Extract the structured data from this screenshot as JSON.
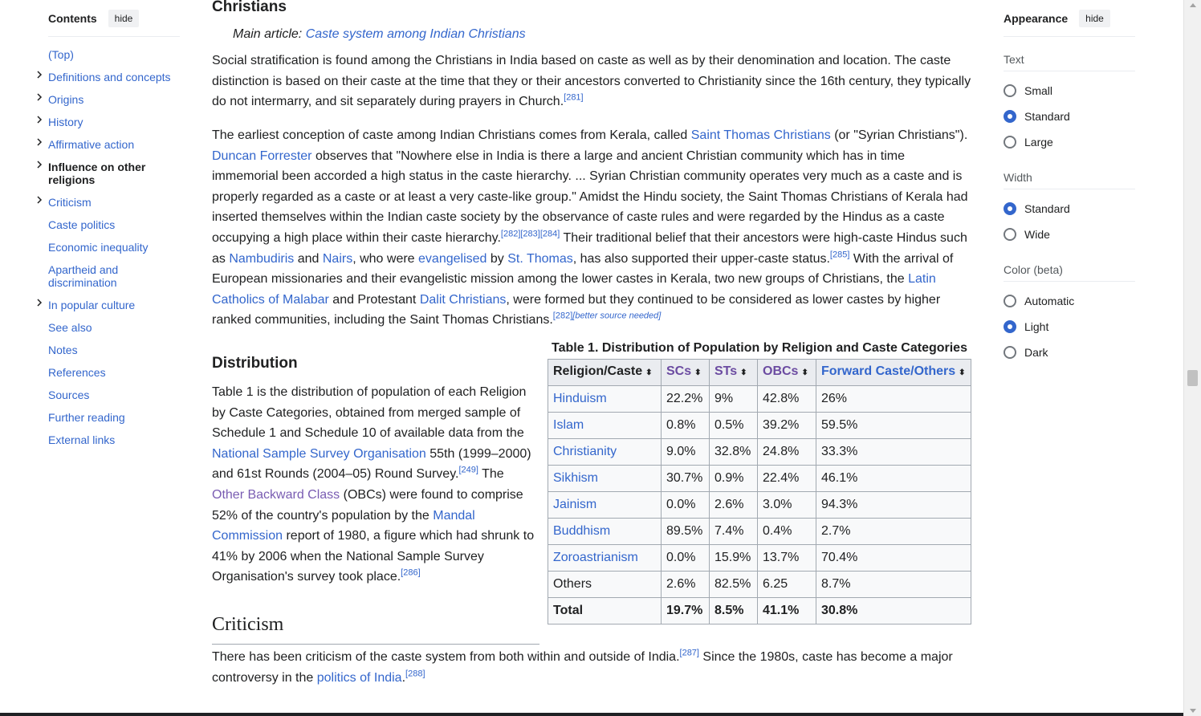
{
  "toc": {
    "title": "Contents",
    "hide_label": "hide",
    "items": [
      {
        "label": "(Top)",
        "expandable": false
      },
      {
        "label": "Definitions and concepts",
        "expandable": true
      },
      {
        "label": "Origins",
        "expandable": true
      },
      {
        "label": "History",
        "expandable": true
      },
      {
        "label": "Affirmative action",
        "expandable": true
      },
      {
        "label": "Influence on other religions",
        "expandable": true,
        "active": true
      },
      {
        "label": "Criticism",
        "expandable": true
      },
      {
        "label": "Caste politics",
        "expandable": false
      },
      {
        "label": "Economic inequality",
        "expandable": false
      },
      {
        "label": "Apartheid and discrimination",
        "expandable": false
      },
      {
        "label": "In popular culture",
        "expandable": true
      },
      {
        "label": "See also",
        "expandable": false
      },
      {
        "label": "Notes",
        "expandable": false
      },
      {
        "label": "References",
        "expandable": false
      },
      {
        "label": "Sources",
        "expandable": false
      },
      {
        "label": "Further reading",
        "expandable": false
      },
      {
        "label": "External links",
        "expandable": false
      }
    ]
  },
  "article": {
    "christians": {
      "heading": "Christians",
      "hatnote_prefix": "Main article: ",
      "hatnote_link": "Caste system among Indian Christians",
      "p1": {
        "text": "Social stratification is found among the Christians in India based on caste as well as by their denomination and location. The caste distinction is based on their caste at the time that they or their ancestors converted to Christianity since the 16th century, they typically do not intermarry, and sit separately during prayers in Church.",
        "ref": "[281]"
      },
      "p2": {
        "t1": "The earliest conception of caste among Indian Christians comes from Kerala, called ",
        "l1": "Saint Thomas Christians",
        "t2": " (or \"Syrian Christians\"). ",
        "l2": "Duncan Forrester",
        "t3": " observes that \"Nowhere else in India is there a large and ancient Christian community which has in time immemorial been accorded a high status in the caste hierarchy. ... Syrian Christian community operates very much as a caste and is properly regarded as a caste or at least a very caste-like group.\" Amidst the Hindu society, the Saint Thomas Christians of Kerala had inserted themselves within the Indian caste society by the observance of caste rules and were regarded by the Hindus as a caste occupying a high place within their caste hierarchy.",
        "r1": "[282][283][284]",
        "t4": " Their traditional belief that their ancestors were high-caste Hindus such as ",
        "l3": "Nambudiris",
        "t5": " and ",
        "l4": "Nairs",
        "t6": ", who were ",
        "l5": "evangelised",
        "t7": " by ",
        "l6": "St. Thomas",
        "t8": ", has also supported their upper-caste status.",
        "r2": "[285]",
        "t9": " With the arrival of European missionaries and their evangelistic mission among the lower castes in Kerala, two new groups of Christians, the ",
        "l7": "Latin Catholics of Malabar",
        "t10": " and Protestant ",
        "l8": "Dalit Christians",
        "t11": ", were formed but they continued to be considered as lower castes by higher ranked communities, including the Saint Thomas Christians.",
        "r3": "[282]",
        "r4": "[better source needed]"
      }
    },
    "distribution": {
      "heading": "Distribution",
      "t1": "Table 1 is the distribution of population of each Religion by Caste Categories, obtained from merged sample of Schedule 1 and Schedule 10 of available data from the ",
      "l1": "National Sample Survey Organisation",
      "t2": " 55th (1999–2000) and 61st Rounds (2004–05) Round Survey.",
      "r1": "[249]",
      "t3": " The ",
      "l2": "Other Backward Class",
      "t4": " (OBCs) were found to comprise 52% of the country's population by the ",
      "l3": "Mandal Commission",
      "t5": " report of 1980, a figure which had shrunk to 41% by 2006 when the National Sample Survey Organisation's survey took place.",
      "r2": "[286]"
    },
    "table": {
      "caption": "Table 1. Distribution of Population by Religion and Caste Categories",
      "headers": [
        "Religion/Caste",
        "SCs",
        "STs",
        "OBCs",
        "Forward Caste/Others"
      ],
      "rows": [
        [
          "Hinduism",
          "22.2%",
          "9%",
          "42.8%",
          "26%"
        ],
        [
          "Islam",
          "0.8%",
          "0.5%",
          "39.2%",
          "59.5%"
        ],
        [
          "Christianity",
          "9.0%",
          "32.8%",
          "24.8%",
          "33.3%"
        ],
        [
          "Sikhism",
          "30.7%",
          "0.9%",
          "22.4%",
          "46.1%"
        ],
        [
          "Jainism",
          "0.0%",
          "2.6%",
          "3.0%",
          "94.3%"
        ],
        [
          "Buddhism",
          "89.5%",
          "7.4%",
          "0.4%",
          "2.7%"
        ],
        [
          "Zoroastrianism",
          "0.0%",
          "15.9%",
          "13.7%",
          "70.4%"
        ],
        [
          "Others",
          "2.6%",
          "82.5%",
          "6.25",
          "8.7%"
        ]
      ],
      "total": [
        "Total",
        "19.7%",
        "8.5%",
        "41.1%",
        "30.8%"
      ]
    },
    "criticism": {
      "heading": "Criticism",
      "t1": "There has been criticism of the caste system from both within and outside of India.",
      "r1": "[287]",
      "t2": " Since the 1980s, caste has become a major controversy in the ",
      "l1": "politics of India",
      "t3": ".",
      "r2": "[288]"
    }
  },
  "appearance": {
    "title": "Appearance",
    "hide_label": "hide",
    "groups": [
      {
        "label": "Text",
        "options": [
          "Small",
          "Standard",
          "Large"
        ],
        "selected": 1
      },
      {
        "label": "Width",
        "options": [
          "Standard",
          "Wide"
        ],
        "selected": 0
      },
      {
        "label": "Color (beta)",
        "options": [
          "Automatic",
          "Light",
          "Dark"
        ],
        "selected": 1
      }
    ]
  },
  "colors": {
    "link": "#3366cc",
    "visited_link": "#795cb2",
    "radio_selected": "#3366cc"
  }
}
